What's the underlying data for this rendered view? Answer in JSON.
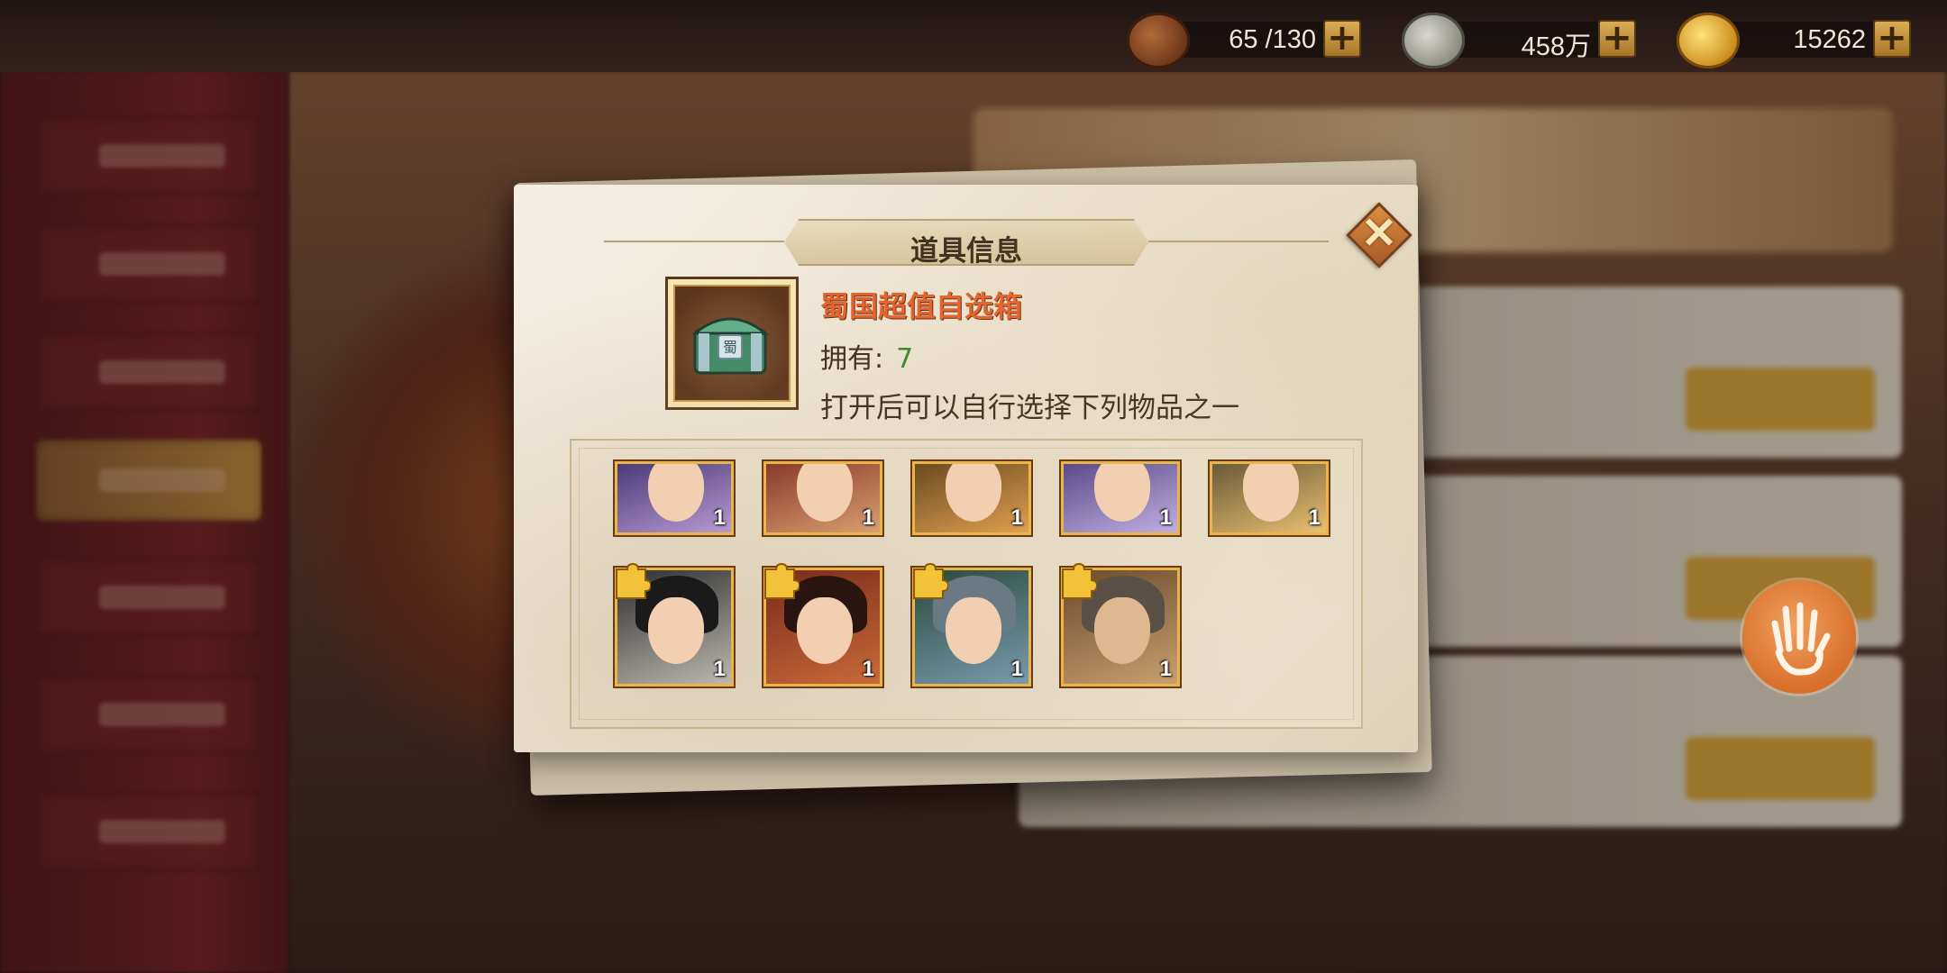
{
  "resources": [
    {
      "name": "stamina",
      "icon": "stamina-icon",
      "value": "65 /130"
    },
    {
      "name": "copper",
      "icon": "coin-icon",
      "value": "458万"
    },
    {
      "name": "gold",
      "icon": "gold-ingot-icon",
      "value": "15262"
    }
  ],
  "dialog": {
    "title": "道具信息",
    "item": {
      "name": "蜀国超值自选箱",
      "owned_label": "拥有:",
      "owned_count": "7",
      "description": "打开后可以自行选择下列物品之一",
      "icon": "jade-chest-icon"
    },
    "rewards_row1": [
      {
        "hero": "hero-portrait-1",
        "count": "1",
        "palette": "#4a3a7a"
      },
      {
        "hero": "hero-portrait-2",
        "count": "1",
        "palette": "#8a3a2a"
      },
      {
        "hero": "hero-portrait-3",
        "count": "1",
        "palette": "#6a4a20"
      },
      {
        "hero": "hero-portrait-4",
        "count": "1",
        "palette": "#5a4a8a"
      },
      {
        "hero": "hero-portrait-5",
        "count": "1",
        "palette": "#6a5a3a"
      }
    ],
    "rewards_row2": [
      {
        "hero": "hero-fragment-1",
        "count": "1",
        "palette": "#3a3a3a"
      },
      {
        "hero": "hero-fragment-2",
        "count": "1",
        "palette": "#7a2a1a"
      },
      {
        "hero": "hero-fragment-3",
        "count": "1",
        "palette": "#2a4a3a"
      },
      {
        "hero": "hero-fragment-4",
        "count": "1",
        "palette": "#6a4a2a"
      }
    ]
  },
  "colors": {
    "accent_orange": "#e4602a",
    "owned_green": "#2f8a2a",
    "frame_gold": "#e7b54a"
  }
}
